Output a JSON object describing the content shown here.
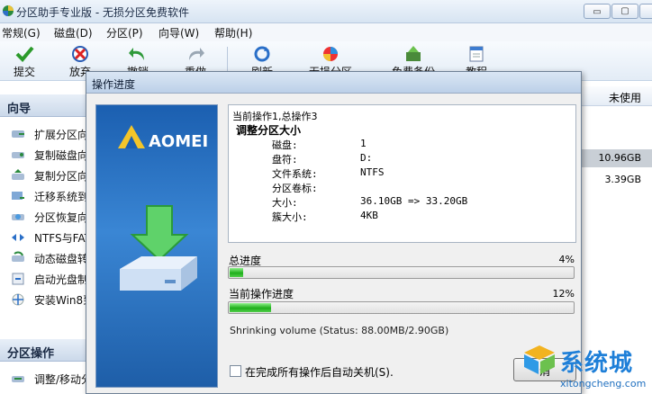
{
  "window": {
    "title": "分区助手专业版 - 无损分区免费软件",
    "controls": {
      "minimize": "▭",
      "maximize": "▢",
      "close": ""
    }
  },
  "menu": [
    "常规(G)",
    "磁盘(D)",
    "分区(P)",
    "向导(W)",
    "帮助(H)"
  ],
  "toolbar": [
    {
      "label": "提交",
      "icon": "check-icon"
    },
    {
      "label": "放弃",
      "icon": "discard-icon"
    },
    {
      "label": "撤销",
      "icon": "undo-icon"
    },
    {
      "label": "重做",
      "icon": "redo-icon"
    },
    {
      "label": "刷新",
      "icon": "refresh-icon"
    },
    {
      "label": "无损分区",
      "icon": "partition-icon"
    },
    {
      "label": "免费备份",
      "icon": "backup-icon"
    },
    {
      "label": "教程",
      "icon": "tutorial-icon"
    }
  ],
  "sidebar": {
    "wizard_header": "向导",
    "wizard_items": [
      {
        "label": "扩展分区向",
        "icon": "extend-partition-icon"
      },
      {
        "label": "复制磁盘向",
        "icon": "copy-disk-icon"
      },
      {
        "label": "复制分区向",
        "icon": "copy-partition-icon"
      },
      {
        "label": "迁移系统到",
        "icon": "migrate-os-icon"
      },
      {
        "label": "分区恢复向",
        "icon": "partition-recovery-icon"
      },
      {
        "label": "NTFS与FAT",
        "icon": "ntfs-fat-icon"
      },
      {
        "label": "动态磁盘转",
        "icon": "dynamic-disk-icon"
      },
      {
        "label": "启动光盘制",
        "icon": "boot-cd-icon"
      },
      {
        "label": "安装Win8到",
        "icon": "windows-install-icon"
      }
    ],
    "ops_header": "分区操作",
    "ops_items": [
      {
        "label": "调整/移动分",
        "icon": "resize-move-icon"
      }
    ]
  },
  "table": {
    "unused_header": "未使用",
    "unused_values": [
      "10.96GB",
      "3.39GB"
    ]
  },
  "dialog": {
    "title": "操作进度",
    "brand": "AOMEI",
    "current_op_line": "当前操作1,总操作3",
    "op_title": "调整分区大小",
    "details": [
      {
        "key": "磁盘:",
        "value": "1"
      },
      {
        "key": "盘符:",
        "value": "D:"
      },
      {
        "key": "文件系统:",
        "value": "NTFS"
      },
      {
        "key": "分区卷标:",
        "value": ""
      },
      {
        "key": "大小:",
        "value": "36.10GB => 33.20GB"
      },
      {
        "key": "簇大小:",
        "value": "4KB"
      }
    ],
    "total_progress": {
      "label": "总进度",
      "percent_text": "4%",
      "fraction": 0.04
    },
    "current_progress": {
      "label": "当前操作进度",
      "percent_text": "12%",
      "fraction": 0.12
    },
    "status": "Shrinking volume (Status: 88.00MB/2.90GB)",
    "auto_shutdown_label": "在完成所有操作后自动关机(S).",
    "cancel_label": "消"
  },
  "watermark": {
    "name": "系统城",
    "url": "xitongcheng.com"
  },
  "colors": {
    "progress_green": "#1fae1b",
    "banner_blue": "#2a73c6",
    "watermark_blue": "#1e7fd8"
  }
}
